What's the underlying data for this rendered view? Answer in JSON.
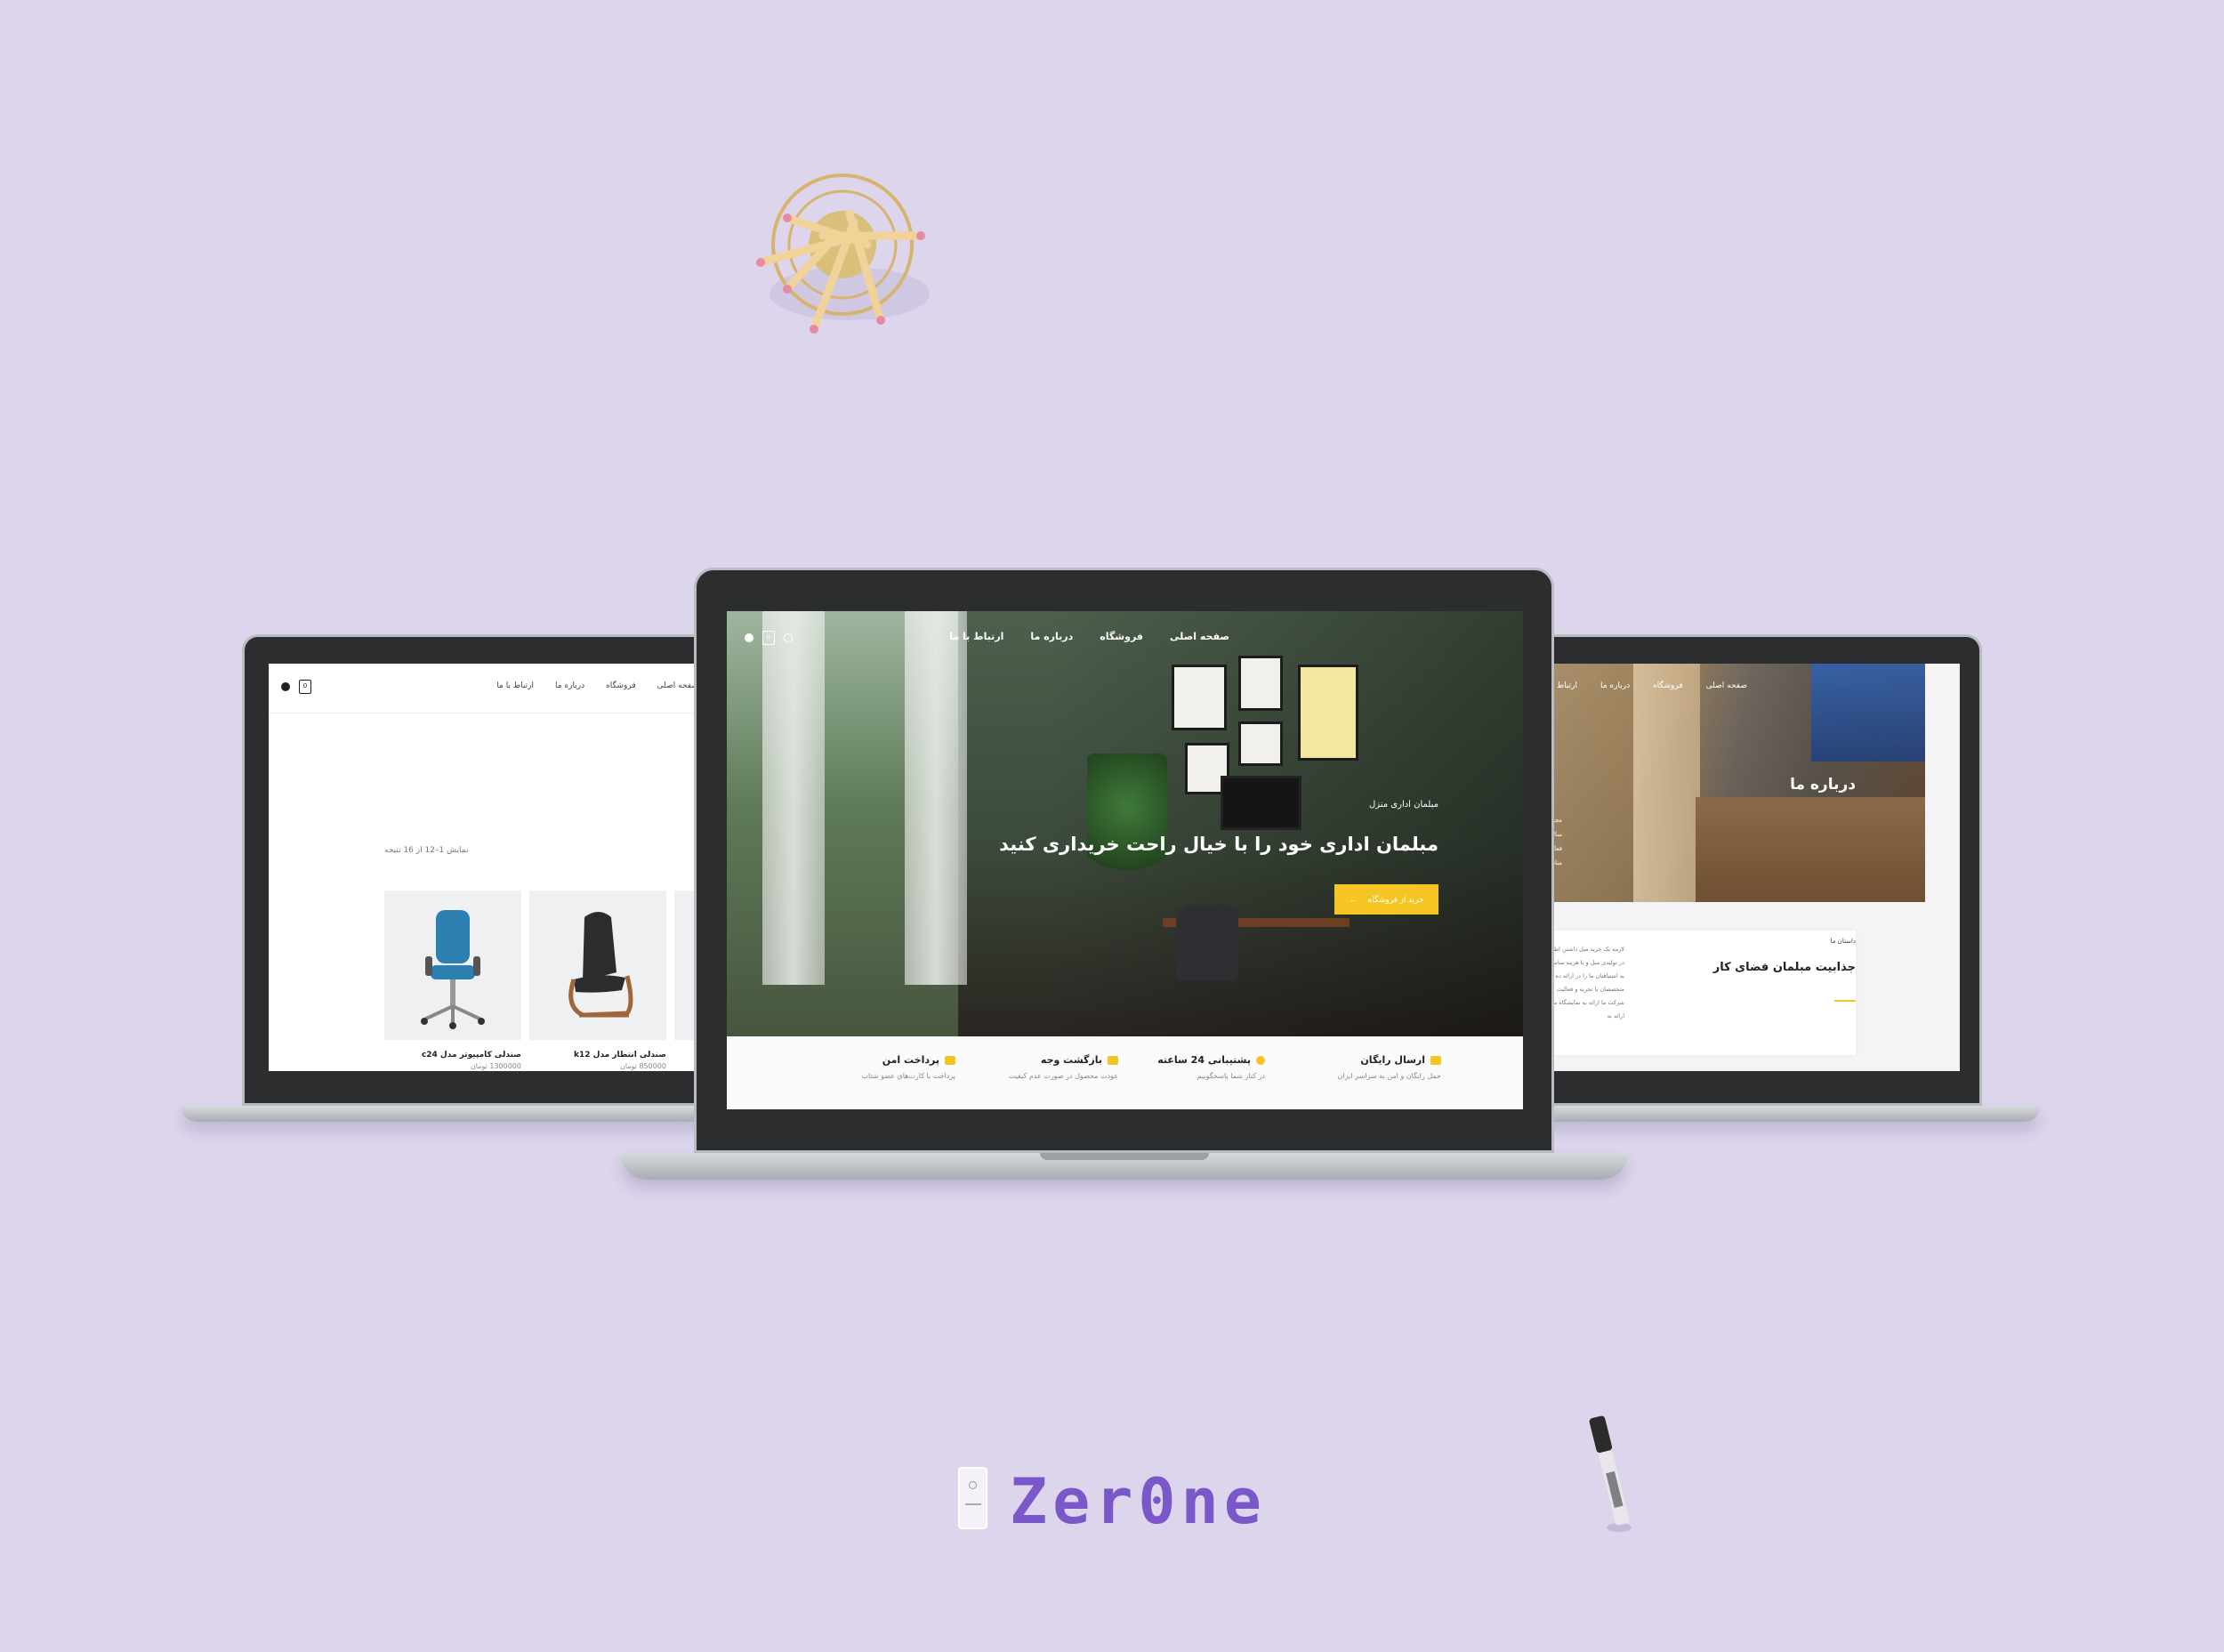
{
  "colors": {
    "background": "#dcd5ec",
    "accent": "#f5c623",
    "brand": "#7a58c9"
  },
  "brand": {
    "name": "Zer0ne"
  },
  "left_screen": {
    "nav": [
      "صفحه اصلی",
      "فروشگاه",
      "درباره ما",
      "ارتباط با ما"
    ],
    "cart_count": "0",
    "result_count": "نمایش 1–12 از 16 نتیجه",
    "products": [
      {
        "name": "صندلی کامپیوتر مدل c24",
        "price": "1300000 تومان",
        "color": "#2c7fb1"
      },
      {
        "name": "صندلی انتظار مدل k12",
        "price": "850000 تومان",
        "color": "#2a2c2e"
      }
    ]
  },
  "center_screen": {
    "nav": [
      "صفحه اصلی",
      "فروشگاه",
      "درباره ما",
      "ارتباط با ما"
    ],
    "cart_count": "0",
    "hero_subtitle": "مبلمان اداری منزل",
    "hero_title": "مبلمان اداری خود را با خیال راحت خریداری کنید",
    "hero_button": "خرید از فروشگاه",
    "hero_button_arrow": "←",
    "features": [
      {
        "title": "ارسال رایگان",
        "desc": "حمل رایگان و امن به سراسر ایران",
        "icon": "truck-icon"
      },
      {
        "title": "پشتیبانی 24 ساعته",
        "desc": "در کنار شما پاسخگوییم",
        "icon": "clock-icon"
      },
      {
        "title": "بازگشت وجه",
        "desc": "عودت محصول در صورت عدم کیفیت",
        "icon": "money-icon"
      },
      {
        "title": "پرداخت امن",
        "desc": "پرداخت با کارت‌های عضو شتاب",
        "icon": "card-icon"
      }
    ]
  },
  "right_screen": {
    "nav": [
      "صفحه اصلی",
      "فروشگاه",
      "درباره ما",
      "ارتباط با"
    ],
    "page_title": "درباره ما",
    "side_text": [
      "مجموعه مبل و د",
      "سال 1378 فعالیت",
      "مناسب با فرصت"
    ],
    "story_label": "داستان ما",
    "story_heading": "جذابیت مبلمان فضای کار",
    "story_text": "لازمه یک خرید مبل داشتن اط باشد. تلاش ما در تولیدی مبل و با هزینه مناسب فراهم کنیم به اشتیاقیان ما را در ارائه ده توسط متخصصان با تجربه و فعالیت می کند. شرکت ما ارائه به نمایشگاه ما و مشاهده از ارائه به"
  }
}
